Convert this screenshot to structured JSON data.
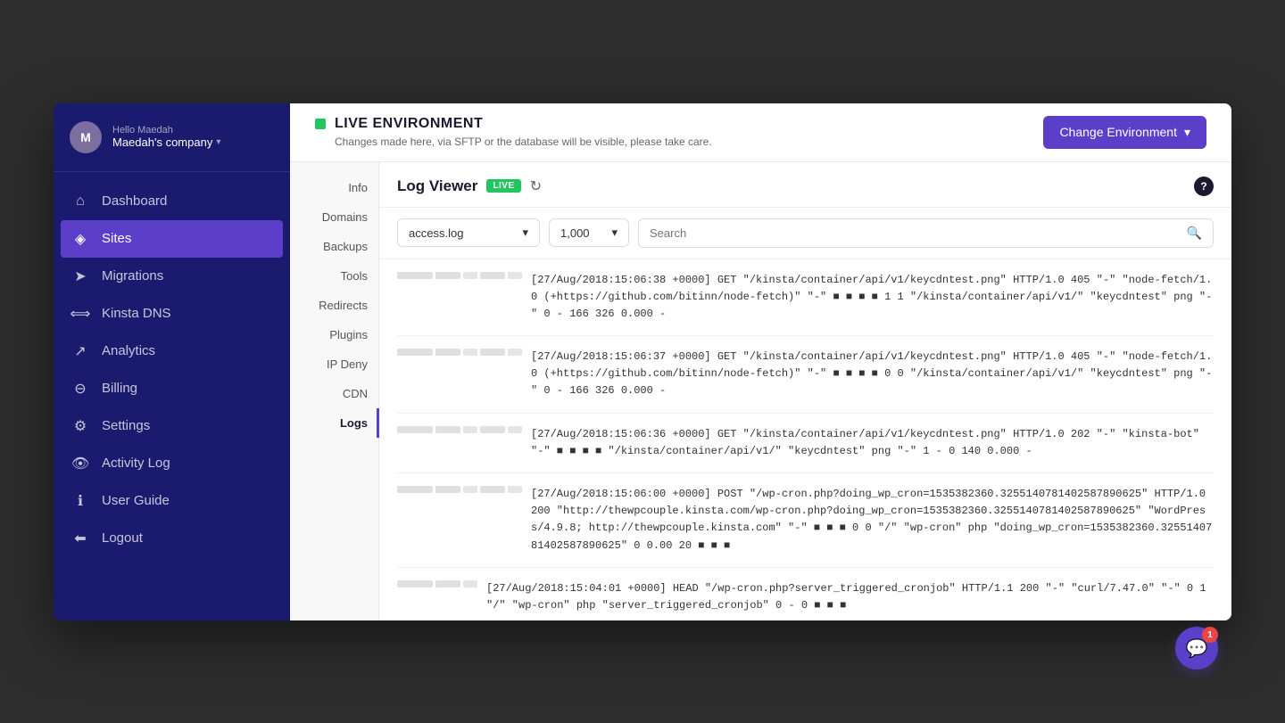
{
  "sidebar": {
    "user": {
      "hello": "Hello Maedah",
      "company": "Maedah's company",
      "avatar_initials": "M"
    },
    "nav_items": [
      {
        "id": "dashboard",
        "label": "Dashboard",
        "icon": "⌂",
        "active": false
      },
      {
        "id": "sites",
        "label": "Sites",
        "icon": "◈",
        "active": true
      },
      {
        "id": "migrations",
        "label": "Migrations",
        "icon": "➤",
        "active": false
      },
      {
        "id": "kinsta-dns",
        "label": "Kinsta DNS",
        "icon": "⟺",
        "active": false
      },
      {
        "id": "analytics",
        "label": "Analytics",
        "icon": "↗",
        "active": false
      },
      {
        "id": "billing",
        "label": "Billing",
        "icon": "⊖",
        "active": false
      },
      {
        "id": "settings",
        "label": "Settings",
        "icon": "⚙",
        "active": false
      },
      {
        "id": "activity-log",
        "label": "Activity Log",
        "icon": "👁",
        "active": false
      },
      {
        "id": "user-guide",
        "label": "User Guide",
        "icon": "ℹ",
        "active": false
      },
      {
        "id": "logout",
        "label": "Logout",
        "icon": "←",
        "active": false
      }
    ]
  },
  "environment": {
    "title": "LIVE ENVIRONMENT",
    "subtitle": "Changes made here, via SFTP or the database will be visible, please take care.",
    "change_btn": "Change Environment"
  },
  "sub_nav": {
    "items": [
      {
        "label": "Info",
        "active": false
      },
      {
        "label": "Domains",
        "active": false
      },
      {
        "label": "Backups",
        "active": false
      },
      {
        "label": "Tools",
        "active": false
      },
      {
        "label": "Redirects",
        "active": false
      },
      {
        "label": "Plugins",
        "active": false
      },
      {
        "label": "IP Deny",
        "active": false
      },
      {
        "label": "CDN",
        "active": false
      },
      {
        "label": "Logs",
        "active": true
      }
    ]
  },
  "log_viewer": {
    "title": "Log Viewer",
    "live_badge": "LIVE",
    "file_select": "access.log",
    "lines_select": "1,000",
    "search_placeholder": "Search",
    "help_label": "?",
    "entries": [
      {
        "id": 1,
        "text": "[27/Aug/2018:15:06:38 +0000] GET \"/kinsta/container/api/v1/keycdntest.png\" HTTP/1.0 405 \"-\" \"node-fetch/1.0 (+https://github.com/bitinn/node-fetch)\" \"-\" ■ ■ ■ ■ 1 1 \"/kinsta/container/api/v1/\" \"keycdntest\" png \"-\" 0 - 166 326 0.000 -"
      },
      {
        "id": 2,
        "text": "[27/Aug/2018:15:06:37 +0000] GET \"/kinsta/container/api/v1/keycdntest.png\" HTTP/1.0 405 \"-\" \"node-fetch/1.0 (+https://github.com/bitinn/node-fetch)\" \"-\" ■ ■ ■ ■ 0 0 \"/kinsta/container/api/v1/\" \"keycdntest\" png \"-\" 0 - 166 326 0.000 -"
      },
      {
        "id": 3,
        "text": "[27/Aug/2018:15:06:36 +0000] GET \"/kinsta/container/api/v1/keycdntest.png\" HTTP/1.0 202 \"-\" \"kinsta-bot\" \"-\" ■ ■ ■ ■ \"/kinsta/container/api/v1/\" \"keycdntest\" png \"-\" 1 - 0 140 0.000 -"
      },
      {
        "id": 4,
        "text": "[27/Aug/2018:15:06:00 +0000] POST \"/wp-cron.php?doing_wp_cron=1535382360.3255140781402587890625\" HTTP/1.0 200 \"http://thewpcouple.kinsta.com/wp-cron.php?doing_wp_cron=1535382360.3255140781402587890625\" \"WordPress/4.9.8; http://thewpcouple.kinsta.com\" \"-\" ■ ■ ■ 0 0 \"/\" \"wp-cron\" php \"doing_wp_cron=1535382360.3255140781402587890625\" 0 0.00 20 ■ ■ ■"
      },
      {
        "id": 5,
        "text": "[27/Aug/2018:15:04:01 +0000] HEAD \"/wp-cron.php?server_triggered_cronjob\" HTTP/1.1 200 \"-\" \"curl/7.47.0\" \"-\" 0 1 \"/\" \"wp-cron\" php \"server_triggered_cronjob\" 0 - 0 ■ ■ ■"
      }
    ]
  },
  "chat": {
    "badge_count": "1"
  },
  "colors": {
    "sidebar_bg": "#1a1a6e",
    "active_nav": "#5b3fc8",
    "live_green": "#22c55e",
    "accent": "#5b3fc8"
  }
}
